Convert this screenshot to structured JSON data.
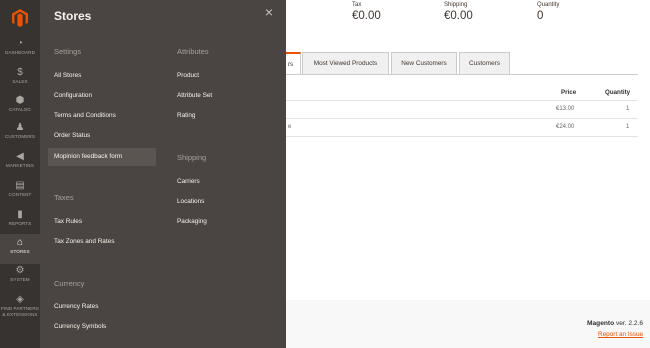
{
  "nav": {
    "items": [
      {
        "label": "DASHBOARD",
        "icon": "dashboard-icon"
      },
      {
        "label": "SALES",
        "icon": "dollar-icon"
      },
      {
        "label": "CATALOG",
        "icon": "box-icon"
      },
      {
        "label": "CUSTOMERS",
        "icon": "person-icon"
      },
      {
        "label": "MARKETING",
        "icon": "megaphone-icon"
      },
      {
        "label": "CONTENT",
        "icon": "content-icon"
      },
      {
        "label": "REPORTS",
        "icon": "bar-chart-icon"
      },
      {
        "label": "STORES",
        "icon": "storefront-icon"
      },
      {
        "label": "SYSTEM",
        "icon": "gear-icon"
      },
      {
        "label": "FIND PARTNERS",
        "label2": "& EXTENSIONS",
        "icon": "cube-icon"
      }
    ],
    "active": "STORES"
  },
  "flyout": {
    "title": "Stores",
    "close": "×",
    "settings": {
      "title": "Settings",
      "links": [
        "All Stores",
        "Configuration",
        "Terms and Conditions",
        "Order Status",
        "Mopinion feedback form"
      ]
    },
    "taxes": {
      "title": "Taxes",
      "links": [
        "Tax Rules",
        "Tax Zones and Rates"
      ]
    },
    "currency": {
      "title": "Currency",
      "links": [
        "Currency Rates",
        "Currency Symbols"
      ]
    },
    "attributes": {
      "title": "Attributes",
      "links": [
        "Product",
        "Attribute Set",
        "Rating"
      ]
    },
    "shipping": {
      "title": "Shipping",
      "links": [
        "Carriers",
        "Locations",
        "Packaging"
      ]
    }
  },
  "stats": [
    {
      "label": "Tax",
      "value": "€0.00"
    },
    {
      "label": "Shipping",
      "value": "€0.00"
    },
    {
      "label": "Quantity",
      "value": "0"
    }
  ],
  "tabs": {
    "active_fragment": "rs",
    "items": [
      "Most Viewed Products",
      "New Customers",
      "Customers"
    ]
  },
  "table": {
    "headers": {
      "price": "Price",
      "quantity": "Quantity"
    },
    "rows": [
      {
        "fragment": "",
        "price": "€13.00",
        "quantity": "1"
      },
      {
        "fragment": "e",
        "price": "€24.00",
        "quantity": "1"
      }
    ]
  },
  "footer": {
    "brand": "Magento",
    "version": " ver. 2.2.6",
    "report": "Report an Issue"
  },
  "colors": {
    "accent": "#eb5202",
    "nav_bg": "#373330",
    "flyout_bg": "#4a4542"
  }
}
